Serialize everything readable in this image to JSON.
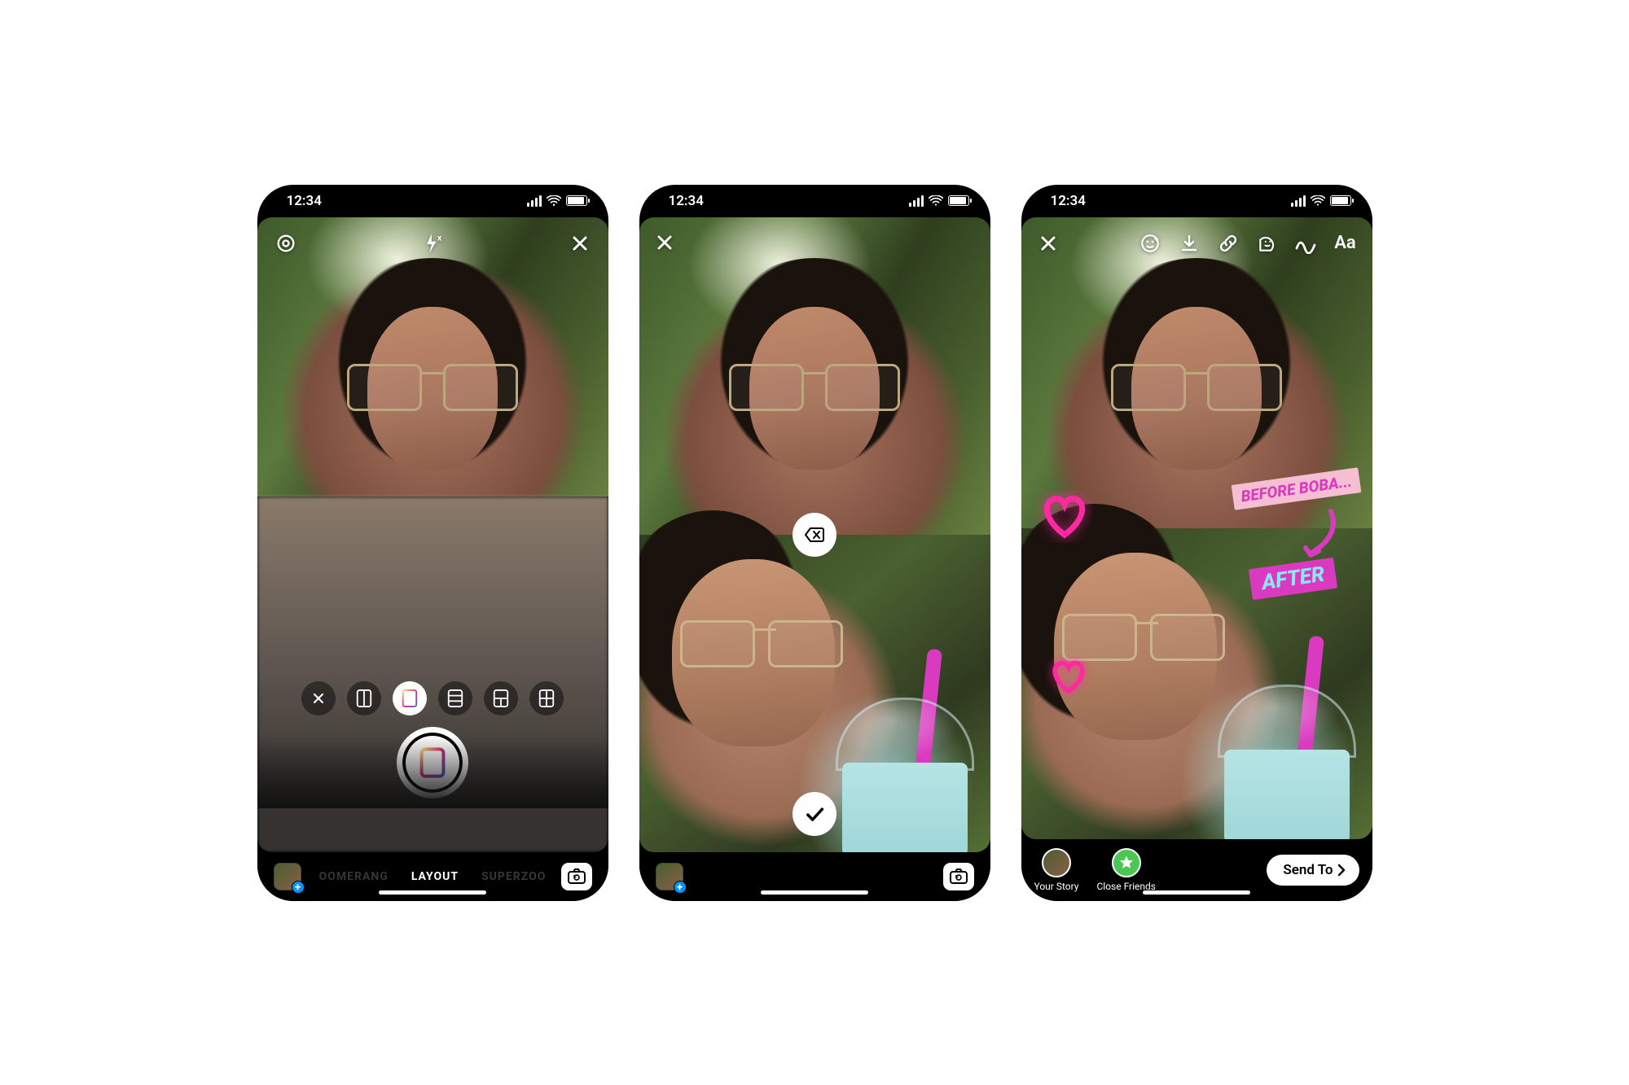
{
  "status": {
    "time": "12:34"
  },
  "screen1": {
    "modes": {
      "prev": "OOMERANG",
      "current": "LAYOUT",
      "next": "SUPERZOO"
    },
    "icons": {
      "settings": "settings-icon",
      "flash": "flash-off-icon",
      "close": "close-icon",
      "flip": "flip-camera-icon"
    },
    "layouts": [
      "clear",
      "2h",
      "2v-selected",
      "3h",
      "1+1",
      "4grid"
    ]
  },
  "screen2": {
    "icons": {
      "close": "close-icon",
      "delete_last": "delete-last-icon",
      "confirm": "checkmark-icon",
      "flip": "flip-camera-icon"
    }
  },
  "screen3": {
    "toolbar": {
      "close": "close-icon",
      "effects": "face-effects-icon",
      "download": "download-icon",
      "link": "link-icon",
      "stickers": "sticker-icon",
      "draw": "draw-icon",
      "text_label": "Aa"
    },
    "stickers": {
      "text1": "BEFORE BOBA...",
      "text2": "AFTER"
    },
    "share": {
      "your_story": "Your Story",
      "close_friends": "Close Friends",
      "send_to": "Send To"
    }
  }
}
